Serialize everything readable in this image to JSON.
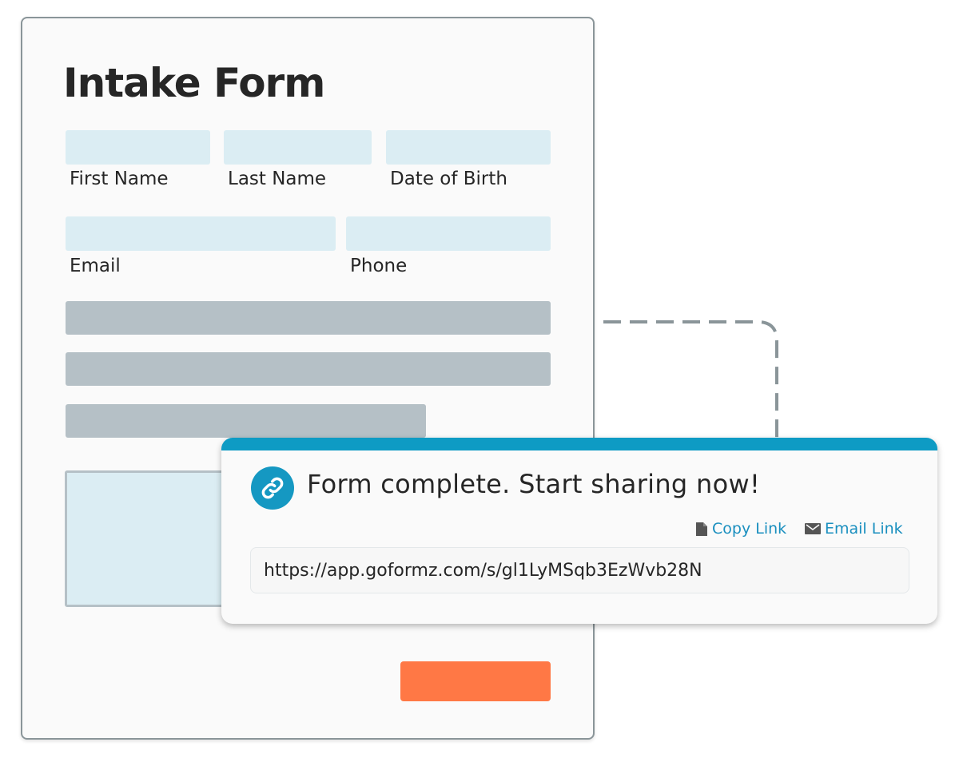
{
  "form": {
    "title": "Intake Form",
    "fields": {
      "first_name": "First Name",
      "last_name": "Last Name",
      "date_of_birth": "Date of Birth",
      "email": "Email",
      "phone": "Phone"
    }
  },
  "share_popup": {
    "title": "Form complete. Start sharing now!",
    "copy_link_label": "Copy Link",
    "email_link_label": "Email Link",
    "share_url": "https://app.goformz.com/s/gl1LyMSqb3EzWvb28N",
    "icons": {
      "header": "link-icon",
      "copy": "document-icon",
      "email": "envelope-icon"
    }
  },
  "colors": {
    "accent": "#0e9bc4",
    "link_text": "#1a8fbf",
    "field_fill": "#dbedf3",
    "placeholder_bar": "#b5c0c6",
    "submit_button": "#ff7845",
    "connector": "#8a9599"
  }
}
